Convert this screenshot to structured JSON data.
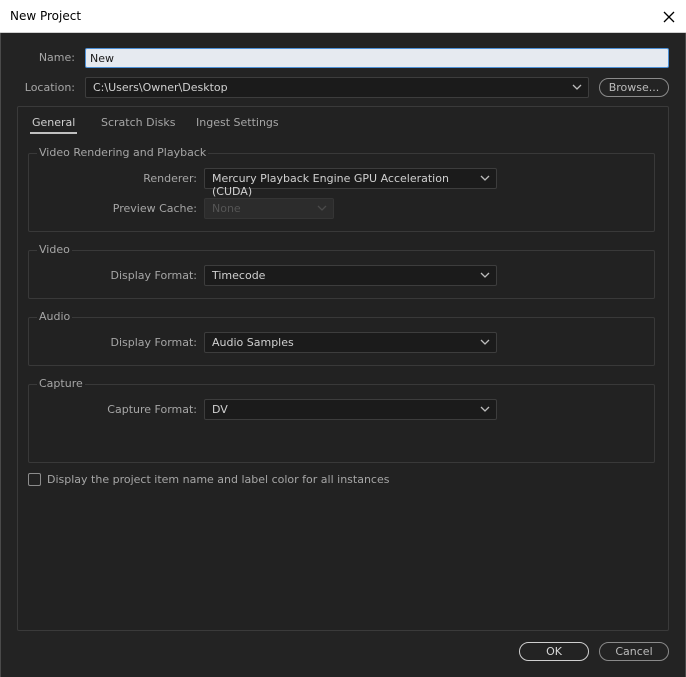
{
  "window": {
    "title": "New Project"
  },
  "name": {
    "label": "Name:",
    "value": "New"
  },
  "location": {
    "label": "Location:",
    "value": "C:\\Users\\Owner\\Desktop",
    "browse_label": "Browse..."
  },
  "tabs": [
    {
      "label": "General",
      "active": true
    },
    {
      "label": "Scratch Disks",
      "active": false
    },
    {
      "label": "Ingest Settings",
      "active": false
    }
  ],
  "video_rendering": {
    "legend": "Video Rendering and Playback",
    "renderer_label": "Renderer:",
    "renderer_value": "Mercury Playback Engine GPU Acceleration (CUDA)",
    "preview_cache_label": "Preview Cache:",
    "preview_cache_value": "None"
  },
  "video": {
    "legend": "Video",
    "display_format_label": "Display Format:",
    "display_format_value": "Timecode"
  },
  "audio": {
    "legend": "Audio",
    "display_format_label": "Display Format:",
    "display_format_value": "Audio Samples"
  },
  "capture": {
    "legend": "Capture",
    "capture_format_label": "Capture Format:",
    "capture_format_value": "DV"
  },
  "display_item_name": {
    "label": "Display the project item name and label color for all instances",
    "checked": false
  },
  "buttons": {
    "ok": "OK",
    "cancel": "Cancel"
  },
  "colors": {
    "background": "#232323",
    "input_focus_border": "#4d90d6"
  }
}
